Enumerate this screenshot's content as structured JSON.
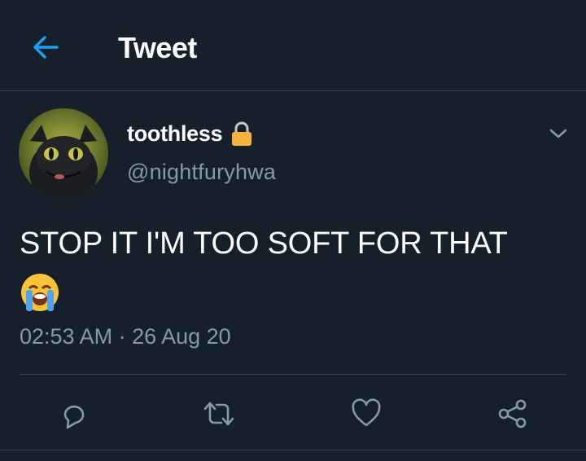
{
  "colors": {
    "background": "#15202b",
    "accent": "#1da1f2",
    "secondary_text": "#8899a6",
    "divider": "#38444d",
    "lock": "#f7b23b"
  },
  "header": {
    "back_icon": "arrow-left-icon",
    "title": "Tweet"
  },
  "tweet": {
    "author": {
      "display_name": "toothless",
      "handle": "@nightfuryhwa",
      "protected_icon": "lock-icon",
      "avatar_icon": "avatar-image"
    },
    "menu_icon": "chevron-down-icon",
    "text": "STOP IT I'M TOO SOFT FOR THAT",
    "emoji": "loudly-crying-face-emoji",
    "timestamp": "02:53 AM · 26 Aug 20",
    "actions": [
      {
        "name": "reply",
        "icon": "reply-icon"
      },
      {
        "name": "retweet",
        "icon": "retweet-icon"
      },
      {
        "name": "like",
        "icon": "heart-icon"
      },
      {
        "name": "share",
        "icon": "share-icon"
      }
    ]
  }
}
